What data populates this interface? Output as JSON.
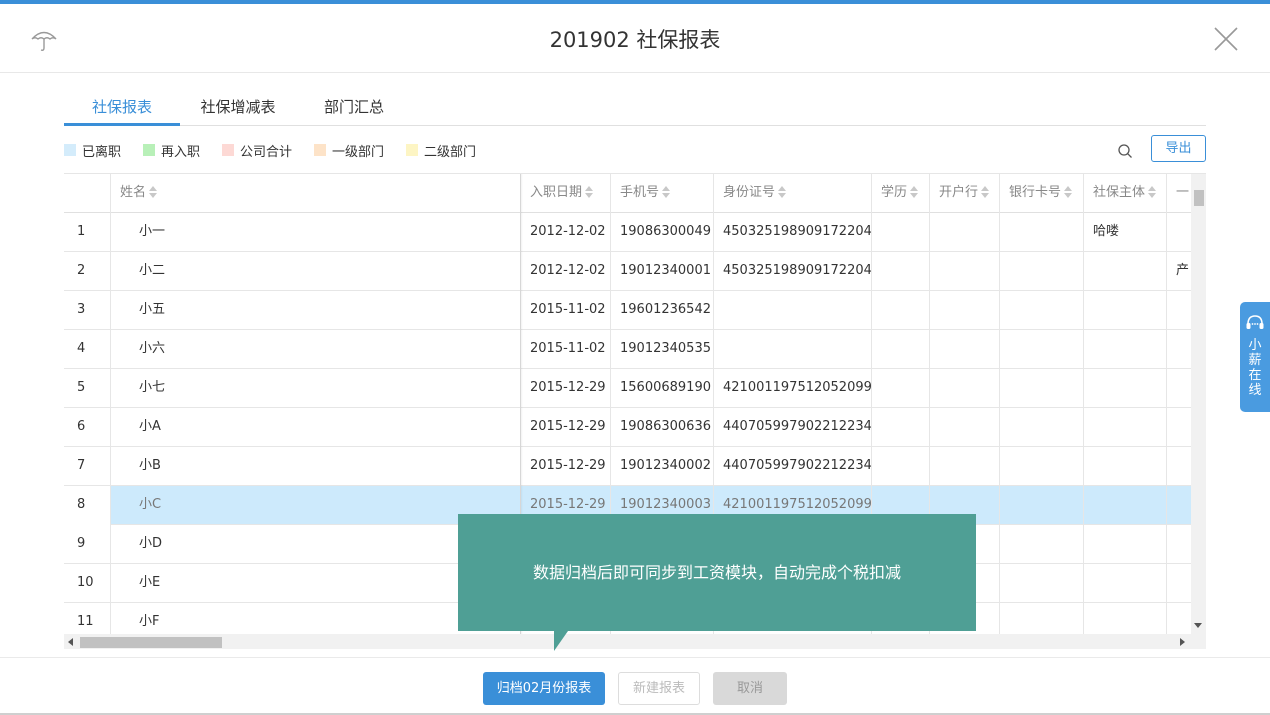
{
  "dialog": {
    "title": "201902 社保报表"
  },
  "tabs": [
    {
      "label": "社保报表",
      "active": true
    },
    {
      "label": "社保增减表",
      "active": false
    },
    {
      "label": "部门汇总",
      "active": false
    }
  ],
  "legend": [
    {
      "label": "已离职",
      "color": "#d4ecfb"
    },
    {
      "label": "再入职",
      "color": "#b8f0b8"
    },
    {
      "label": "公司合计",
      "color": "#fdd9d5"
    },
    {
      "label": "一级部门",
      "color": "#fde3c8"
    },
    {
      "label": "二级部门",
      "color": "#fdf5c4"
    }
  ],
  "toolbar": {
    "export_label": "导出",
    "search_icon": "search-icon"
  },
  "table": {
    "columns": [
      "姓名",
      "入职日期",
      "手机号",
      "身份证号",
      "学历",
      "开户行",
      "银行卡号",
      "社保主体",
      "一"
    ],
    "rows": [
      {
        "no": "1",
        "name": "小一",
        "date": "2012-12-02",
        "phone": "19086300049",
        "id": "450325198909172204",
        "social": "哈喽",
        "extra": ""
      },
      {
        "no": "2",
        "name": "小二",
        "date": "2012-12-02",
        "phone": "19012340001",
        "id": "450325198909172204",
        "social": "",
        "extra": "产"
      },
      {
        "no": "3",
        "name": "小五",
        "date": "2015-11-02",
        "phone": "19601236542",
        "id": "",
        "social": "",
        "extra": ""
      },
      {
        "no": "4",
        "name": "小六",
        "date": "2015-11-02",
        "phone": "19012340535",
        "id": "",
        "social": "",
        "extra": ""
      },
      {
        "no": "5",
        "name": "小七",
        "date": "2015-12-29",
        "phone": "15600689190",
        "id": "421001197512052099",
        "social": "",
        "extra": ""
      },
      {
        "no": "6",
        "name": "小A",
        "date": "2015-12-29",
        "phone": "19086300636",
        "id": "440705997902212234",
        "social": "",
        "extra": ""
      },
      {
        "no": "7",
        "name": "小B",
        "date": "2015-12-29",
        "phone": "19012340002",
        "id": "440705997902212234",
        "social": "",
        "extra": ""
      },
      {
        "no": "8",
        "name": "小C",
        "date": "2015-12-29",
        "phone": "19012340003",
        "id": "421001197512052099",
        "social": "",
        "extra": ""
      },
      {
        "no": "9",
        "name": "小D",
        "date": "",
        "phone": "",
        "id": "",
        "social": "",
        "extra": ""
      },
      {
        "no": "10",
        "name": "小E",
        "date": "",
        "phone": "",
        "id": "",
        "social": "",
        "extra": ""
      },
      {
        "no": "11",
        "name": "小F",
        "date": "",
        "phone": "",
        "id": "",
        "social": "",
        "extra": ""
      }
    ]
  },
  "tooltip": {
    "text": "数据归档后即可同步到工资模块，自动完成个税扣减"
  },
  "footer": {
    "archive_label": "归档02月份报表",
    "new_report_label": "新建报表",
    "cancel_label": "取消"
  },
  "side_chat": {
    "label": "小薪在线"
  }
}
